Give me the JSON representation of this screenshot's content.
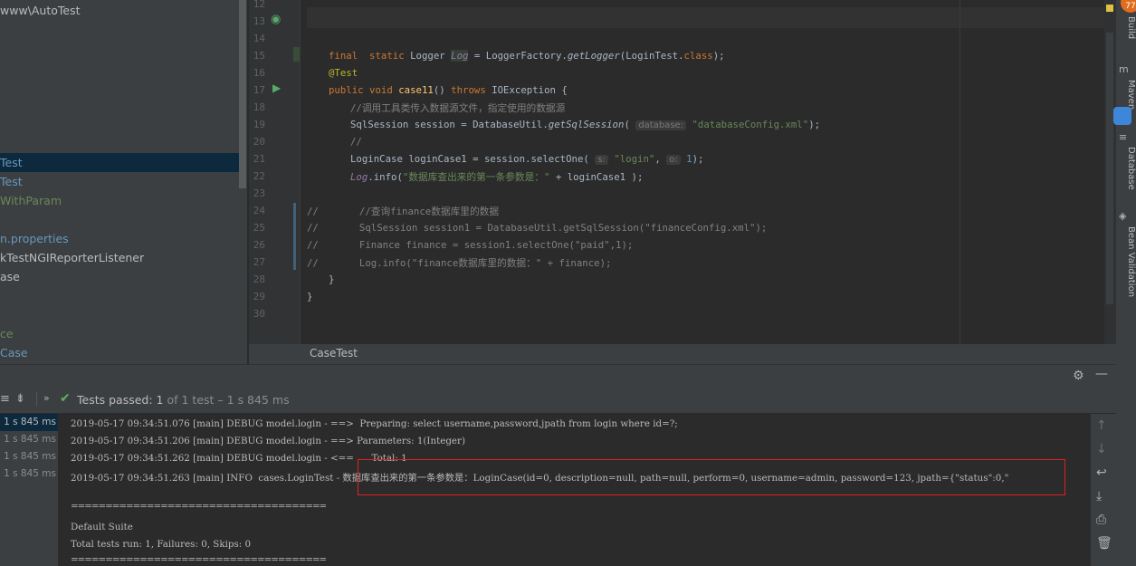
{
  "project_tree": {
    "path_fragment": "www\\AutoTest",
    "items": [
      {
        "label": "Test",
        "color": "#6897bb",
        "selected": true
      },
      {
        "label": "Test",
        "color": "#6897bb",
        "selected": false
      },
      {
        "label": "WithParam",
        "color": "#6a8759",
        "selected": false
      },
      {
        "label": "n.properties",
        "color": "#6897bb",
        "selected": false
      },
      {
        "label": "kTestNGIReporterListener",
        "color": "#bbbbbb",
        "selected": false
      },
      {
        "label": "ase",
        "color": "#bbbbbb",
        "selected": false
      },
      {
        "label": "ce",
        "color": "#6a8759",
        "selected": false
      },
      {
        "label": "Case",
        "color": "#6897bb",
        "selected": false
      }
    ]
  },
  "editor": {
    "line_numbers": [
      "12",
      "13",
      "14",
      "15",
      "16",
      "17",
      "18",
      "19",
      "20",
      "21",
      "22",
      "23",
      "24",
      "25",
      "26",
      "27",
      "28",
      "29",
      "30"
    ],
    "tab_label": "CaseTest",
    "hints": {
      "database": "database:",
      "s": "s:",
      "o": "o:"
    }
  },
  "right_tools": {
    "build": "Build",
    "maven": "Maven",
    "database": "Database",
    "bean_validation": "Bean Validation",
    "badge": "77"
  },
  "run_panel": {
    "status_text": "Tests passed:",
    "passed_count": "1",
    "of_text": "of 1 test",
    "duration": "– 1 s 845 ms",
    "times": [
      "1 s 845 ms",
      "1 s 845 ms",
      "1 s 845 ms",
      "1 s 845 ms"
    ],
    "console_lines": [
      "2019-05-17 09:34:51.076 [main] DEBUG model.login - ==>  Preparing: select username,password,jpath from login where id=?;",
      "2019-05-17 09:34:51.206 [main] DEBUG model.login - ==> Parameters: 1(Integer)",
      "2019-05-17 09:34:51.262 [main] DEBUG model.login - <==      Total: 1",
      "2019-05-17 09:34:51.263 [main] INFO  cases.LoginTest - 数据库查出来的第一条参数是：LoginCase(id=0, description=null, path=null, perform=0, username=admin, password=123, jpath={\"status\":0,\""
    ],
    "separator": "===============================================",
    "suite_name": "Default Suite",
    "summary": "Total tests run: 1, Failures: 0, Skips: 0"
  },
  "colors": {
    "pass_green": "#5fb15f",
    "highlight_box": "#e02020",
    "selected_row": "#0d293e"
  }
}
